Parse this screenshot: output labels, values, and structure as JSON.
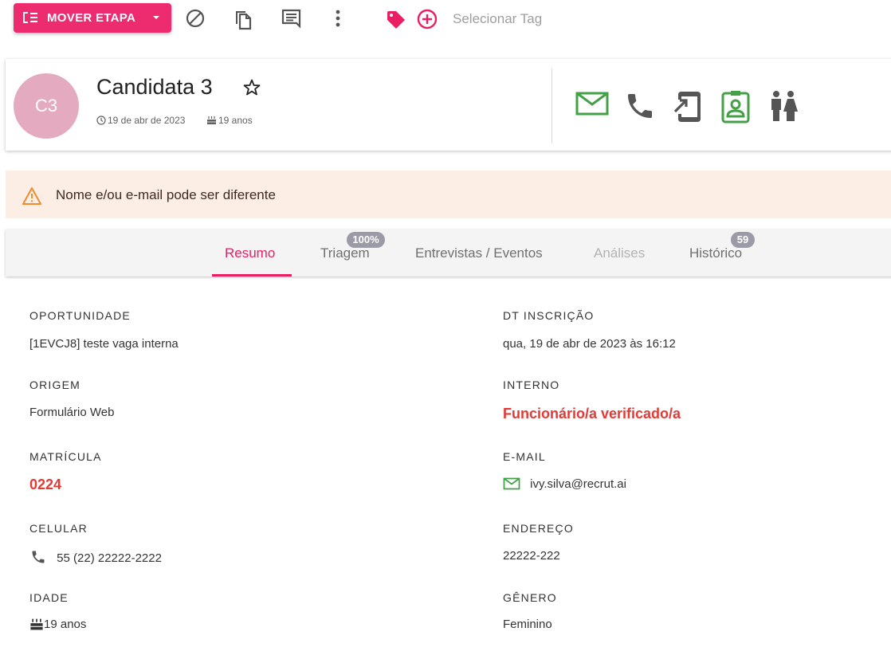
{
  "toolbar": {
    "move_stage_label": "MOVER ETAPA",
    "tag_placeholder": "Selecionar Tag"
  },
  "candidate": {
    "initials": "C3",
    "name": "Candidata 3",
    "date": "19 de abr de 2023",
    "age": "19 anos"
  },
  "warning": {
    "text": "Nome e/ou e-mail pode ser diferente"
  },
  "tabs": [
    {
      "label": "Resumo"
    },
    {
      "label": "Triagem",
      "badge": "100%"
    },
    {
      "label": "Entrevistas / Eventos"
    },
    {
      "label": "Análises"
    },
    {
      "label": "Histórico",
      "badge": "59"
    }
  ],
  "details": {
    "oportunidade": {
      "label": "OPORTUNIDADE",
      "value": "[1EVCJ8] teste vaga interna"
    },
    "inscricao": {
      "label": "DT INSCRIÇÃO",
      "value": "qua, 19 de abr de 2023 às 16:12"
    },
    "origem": {
      "label": "ORIGEM",
      "value": "Formulário Web"
    },
    "interno": {
      "label": "INTERNO",
      "value": "Funcionário/a verificado/a"
    },
    "matricula": {
      "label": "MATRÍCULA",
      "value": "0224"
    },
    "email": {
      "label": "E-MAIL",
      "value": "ivy.silva@recrut.ai"
    },
    "celular": {
      "label": "CELULAR",
      "value": "55 (22) 22222-2222"
    },
    "endereco": {
      "label": "ENDEREÇO",
      "value": "22222-222"
    },
    "idade": {
      "label": "IDADE",
      "value": "19 anos"
    },
    "genero": {
      "label": "GÊNERO",
      "value": "Feminino"
    }
  },
  "colors": {
    "accent": "#ec2c6e",
    "green": "#43a047",
    "alert_red": "#e53935",
    "warning_bg": "#fdeee5",
    "warning_icon": "#f08c2e",
    "avatar_bg": "#e4aac0"
  },
  "icons": {
    "toolbar": [
      "move-stage-icon",
      "caret-down-icon",
      "block-icon",
      "copy-icon",
      "comment-icon",
      "more-vert-icon",
      "tag-icon",
      "add-circle-icon"
    ],
    "actions": [
      "email-icon",
      "phone-icon",
      "send-to-mobile-icon",
      "badge-icon",
      "family-icon"
    ]
  }
}
